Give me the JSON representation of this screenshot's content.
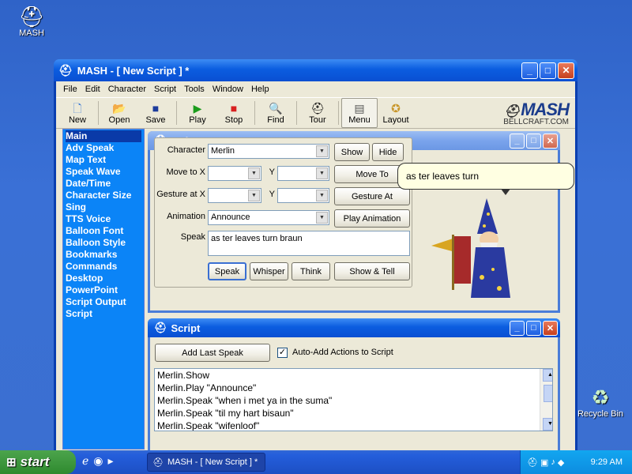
{
  "desktop": {
    "icons": [
      {
        "label": "MASH"
      },
      {
        "label": "Recycle Bin"
      }
    ]
  },
  "window": {
    "title": "MASH - [ New Script ] *",
    "menu": [
      "File",
      "Edit",
      "Character",
      "Script",
      "Tools",
      "Window",
      "Help"
    ],
    "toolbar": [
      {
        "label": "New",
        "icon": "new-document-icon"
      },
      {
        "label": "Open",
        "icon": "open-folder-icon"
      },
      {
        "label": "Save",
        "icon": "save-disk-icon"
      },
      {
        "label": "Play",
        "icon": "play-icon"
      },
      {
        "label": "Stop",
        "icon": "stop-icon"
      },
      {
        "label": "Find",
        "icon": "magnifier-icon"
      },
      {
        "label": "Tour",
        "icon": "wizard-hat-icon"
      },
      {
        "label": "Menu",
        "icon": "menu-icon"
      },
      {
        "label": "Layout",
        "icon": "layout-icon"
      }
    ],
    "brand": {
      "logo": "MASH",
      "url": "BELLCRAFT.COM"
    }
  },
  "sidebar": {
    "items": [
      "Main",
      "Adv Speak",
      "Map Text",
      "Speak Wave",
      "Date/Time",
      "Character Size",
      "Sing",
      "TTS Voice",
      "Balloon Font",
      "Balloon Style",
      "Bookmarks",
      "Commands",
      "Desktop",
      "PowerPoint",
      "Script Output",
      "Script"
    ],
    "selected": "Main"
  },
  "main_panel": {
    "title": "Main",
    "character_label": "Character",
    "character_value": "Merlin",
    "show_label": "Show",
    "hide_label": "Hide",
    "moveto_label": "Move to X",
    "y_label": "Y",
    "moveto_button": "Move To",
    "gesture_label": "Gesture at X",
    "gesture_button": "Gesture At",
    "animation_label": "Animation",
    "animation_value": "Announce",
    "play_animation_button": "Play Animation",
    "speak_label": "Speak",
    "speak_value": "as ter leaves turn braun",
    "buttons": {
      "speak": "Speak",
      "whisper": "Whisper",
      "think": "Think",
      "show_tell": "Show & Tell"
    },
    "balloon_text": "as ter leaves turn"
  },
  "script_panel": {
    "title": "Script",
    "add_last_speak": "Add Last Speak",
    "auto_add_label": "Auto-Add Actions to Script",
    "auto_add_checked": true,
    "lines": [
      "Merlin.Show",
      "Merlin.Play \"Announce\"",
      "Merlin.Speak \"when i met ya in the suma\"",
      "Merlin.Speak \"til my hart bisaun\"",
      "Merlin.Speak \"wifenloof\""
    ]
  },
  "taskbar": {
    "start_label": "start",
    "task_label": "MASH - [ New Script ] *",
    "clock": "9:29 AM"
  }
}
